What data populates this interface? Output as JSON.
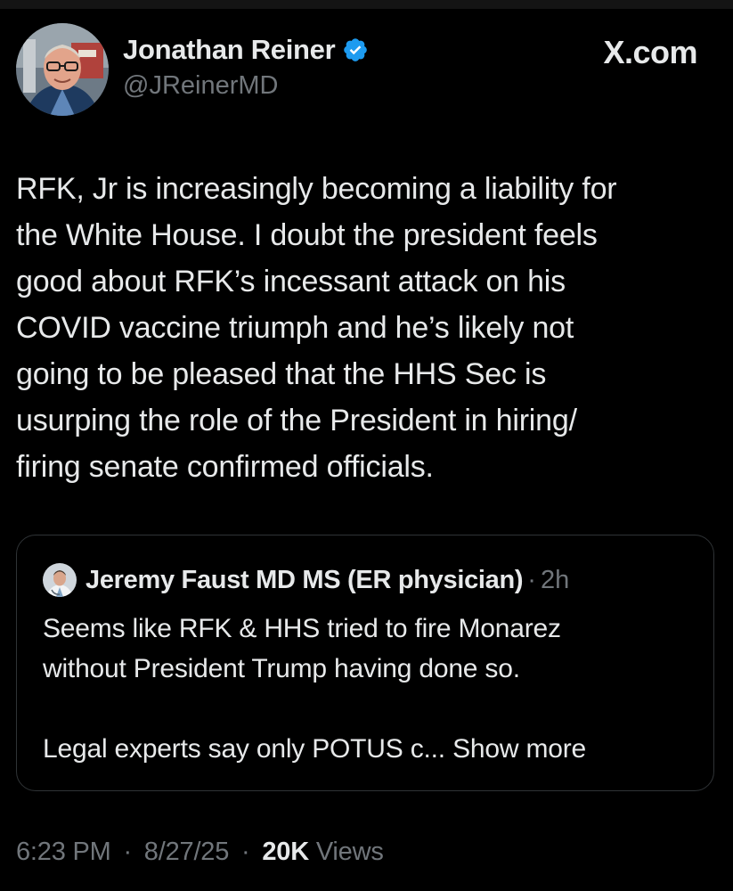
{
  "brand": "X.com",
  "author": {
    "name": "Jonathan Reiner",
    "handle": "@JReinerMD",
    "verified": true
  },
  "tweet": {
    "text": "RFK, Jr is increasingly becoming a liability for\nthe White House. I doubt the president feels\ngood about RFK’s incessant attack on his\nCOVID vaccine triumph and he’s likely not\ngoing to be pleased that the HHS Sec is\nusurping the role of the President in hiring/\nfiring senate confirmed officials."
  },
  "quote": {
    "author_name": "Jeremy Faust MD MS (ER physician)",
    "separator": "·",
    "time": "2h",
    "text": "Seems like RFK & HHS tried to fire Monarez\nwithout President Trump having done so.",
    "truncated_text": "Legal experts say only POTUS c...",
    "show_more_label": "Show more"
  },
  "meta": {
    "time": "6:23 PM",
    "date": "8/27/25",
    "separator": "·",
    "views_count": "20K",
    "views_label": "Views"
  },
  "colors": {
    "background": "#000000",
    "text": "#e7e9ea",
    "secondary": "#71767b",
    "verified_badge": "#1d9bf0",
    "card_border": "#2f3336"
  },
  "icons": {
    "verified": "verified-badge-icon"
  }
}
